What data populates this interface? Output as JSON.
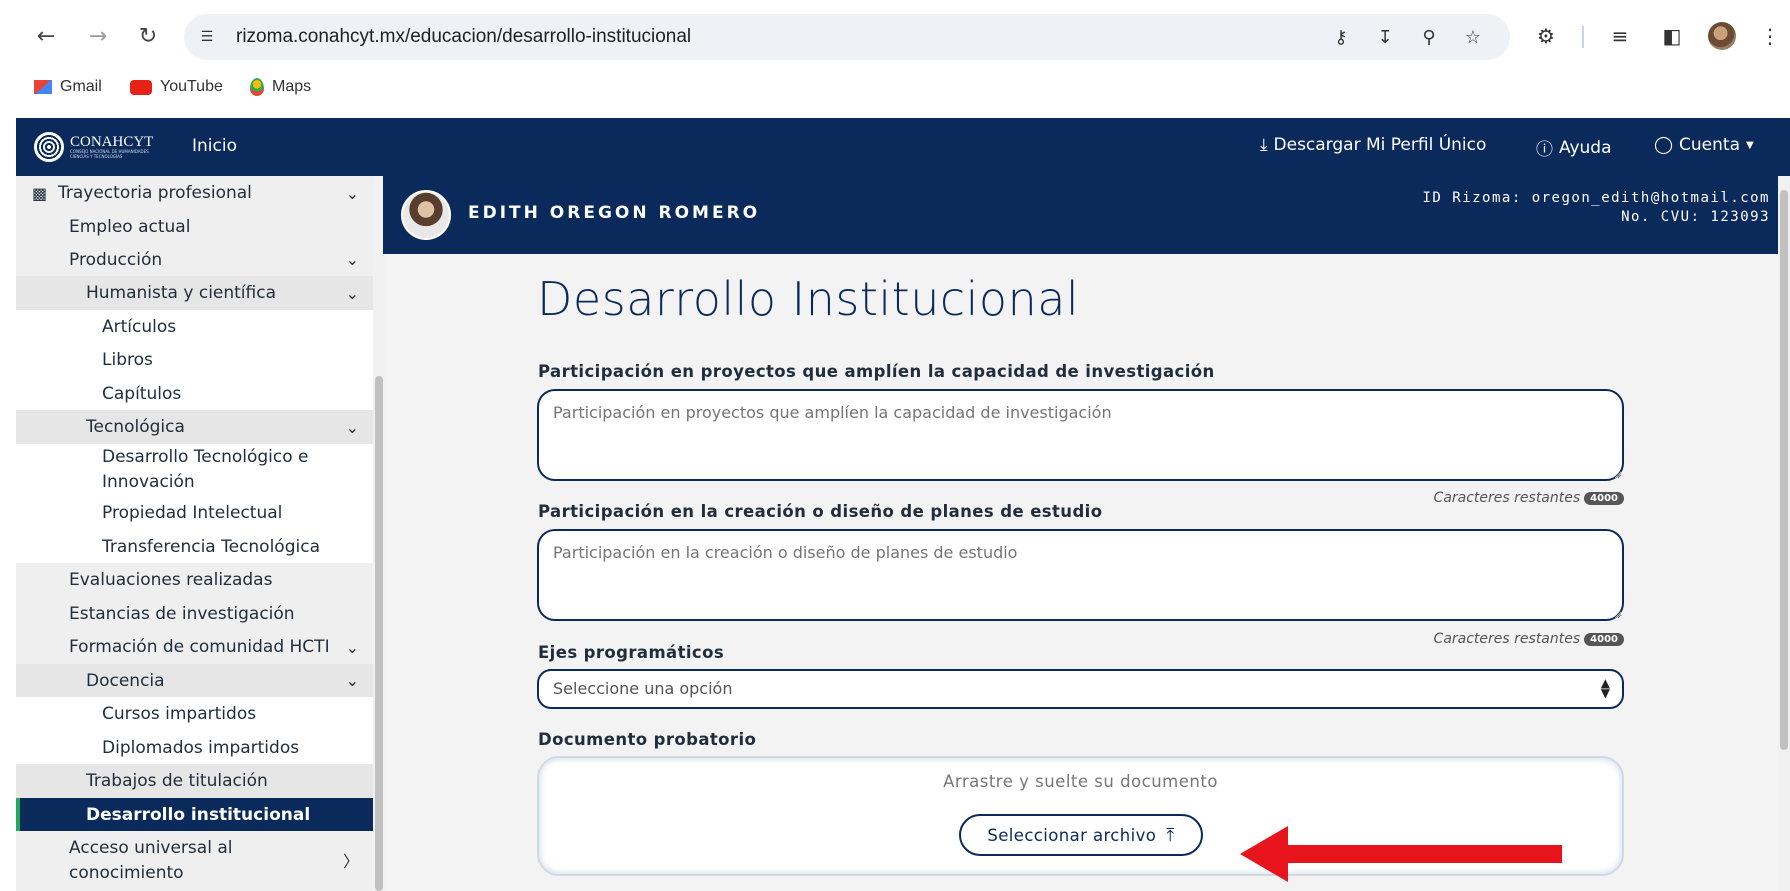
{
  "browser": {
    "url": "rizoma.conahcyt.mx/educacion/desarrollo-institucional",
    "bookmarks": [
      {
        "label": "Gmail",
        "icon": "gmail-icon"
      },
      {
        "label": "YouTube",
        "icon": "youtube-icon"
      },
      {
        "label": "Maps",
        "icon": "maps-icon"
      }
    ]
  },
  "topnav": {
    "logo": "CONAHCYT",
    "logo_sub": "CONSEJO NACIONAL DE HUMANIDADES CIENCIAS Y TECNOLOGÍAS",
    "inicio": "Inicio",
    "download": "Descargar Mi Perfil Único",
    "help": "Ayuda",
    "account": "Cuenta"
  },
  "sidebar": {
    "items": [
      {
        "label": "Trayectoria profesional",
        "level": 0
      },
      {
        "label": "Empleo actual",
        "level": 1
      },
      {
        "label": "Producción",
        "level": 1
      },
      {
        "label": "Humanista y científica",
        "level": 2
      },
      {
        "label": "Artículos",
        "level": 3
      },
      {
        "label": "Libros",
        "level": 3
      },
      {
        "label": "Capítulos",
        "level": 3
      },
      {
        "label": "Tecnológica",
        "level": 2
      },
      {
        "label": "Desarrollo Tecnológico e",
        "label2": "Innovación",
        "level": 3
      },
      {
        "label": "Propiedad Intelectual",
        "level": 3
      },
      {
        "label": "Transferencia Tecnológica",
        "level": 3
      },
      {
        "label": "Evaluaciones realizadas",
        "level": 1
      },
      {
        "label": "Estancias de investigación",
        "level": 1
      },
      {
        "label": "Formación de comunidad HCTI",
        "level": 1
      },
      {
        "label": "Docencia",
        "level": 2
      },
      {
        "label": "Cursos impartidos",
        "level": 3
      },
      {
        "label": "Diplomados impartidos",
        "level": 3
      },
      {
        "label": "Trabajos de titulación",
        "level": 2
      },
      {
        "label": "Desarrollo institucional",
        "level": 2,
        "active": true
      },
      {
        "label": "Acceso universal al",
        "label2": "conocimiento",
        "level": 1
      }
    ]
  },
  "profile": {
    "name": "EDITH OREGON ROMERO",
    "id_line": "ID Rizoma: oregon_edith@hotmail.com",
    "cvu_line": "No. CVU: 123093"
  },
  "form": {
    "title": "Desarrollo Institucional",
    "field1_label": "Participación en proyectos que amplíen la capacidad de investigación",
    "field1_placeholder": "Participación en proyectos que amplíen la capacidad de investigación",
    "field2_label": "Participación en la creación o diseño de planes de estudio",
    "field2_placeholder": "Participación en la creación o diseño de planes de estudio",
    "counter_label": "Caracteres restantes",
    "counter_value": "4000",
    "select_label": "Ejes programáticos",
    "select_value": "Seleccione una opción",
    "doc_label": "Documento probatorio",
    "drop_text": "Arrastre y suelte su documento",
    "file_button": "Seleccionar archivo"
  },
  "colors": {
    "navy": "#0b2a5c",
    "active_accent": "#26a75a",
    "annotation_arrow": "#e8141b"
  }
}
